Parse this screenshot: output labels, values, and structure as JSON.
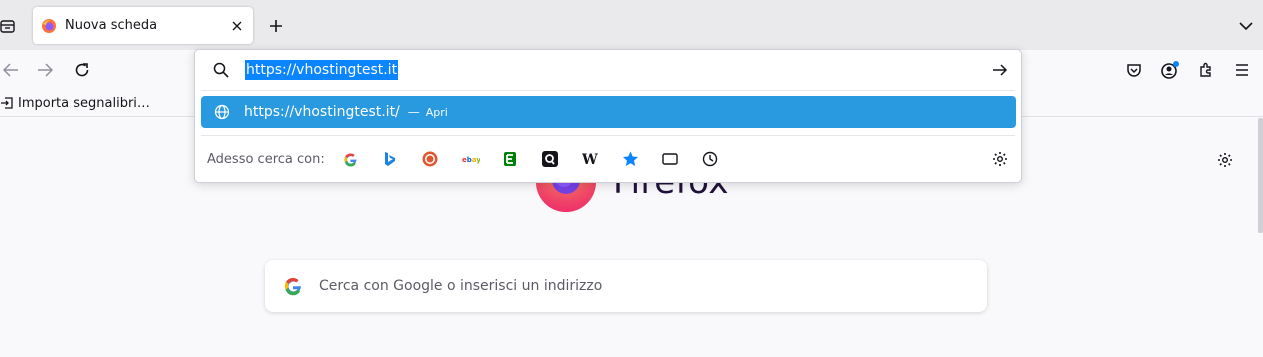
{
  "tab": {
    "title": "Nuova scheda"
  },
  "urlbar": {
    "value": "https://vhostingtest.it",
    "result_url": "https://vhostingtest.it/",
    "result_dash": "—",
    "result_action": "Apri",
    "search_with_label": "Adesso cerca con:",
    "engines": [
      "google-icon",
      "bing-icon",
      "duckduckgo-icon",
      "ebay-icon",
      "ecosia-icon",
      "qwant-icon",
      "wikipedia-icon",
      "bookmarks-icon",
      "tabs-icon",
      "history-icon"
    ]
  },
  "bookmarks": {
    "import_label": "Importa segnalibri…"
  },
  "newtab": {
    "logo_text": "Firefox",
    "search_placeholder": "Cerca con Google o inserisci un indirizzo"
  },
  "colors": {
    "accent": "#0a84ff",
    "result_highlight": "#2a9ae0",
    "tabstrip": "#eaeaed"
  }
}
